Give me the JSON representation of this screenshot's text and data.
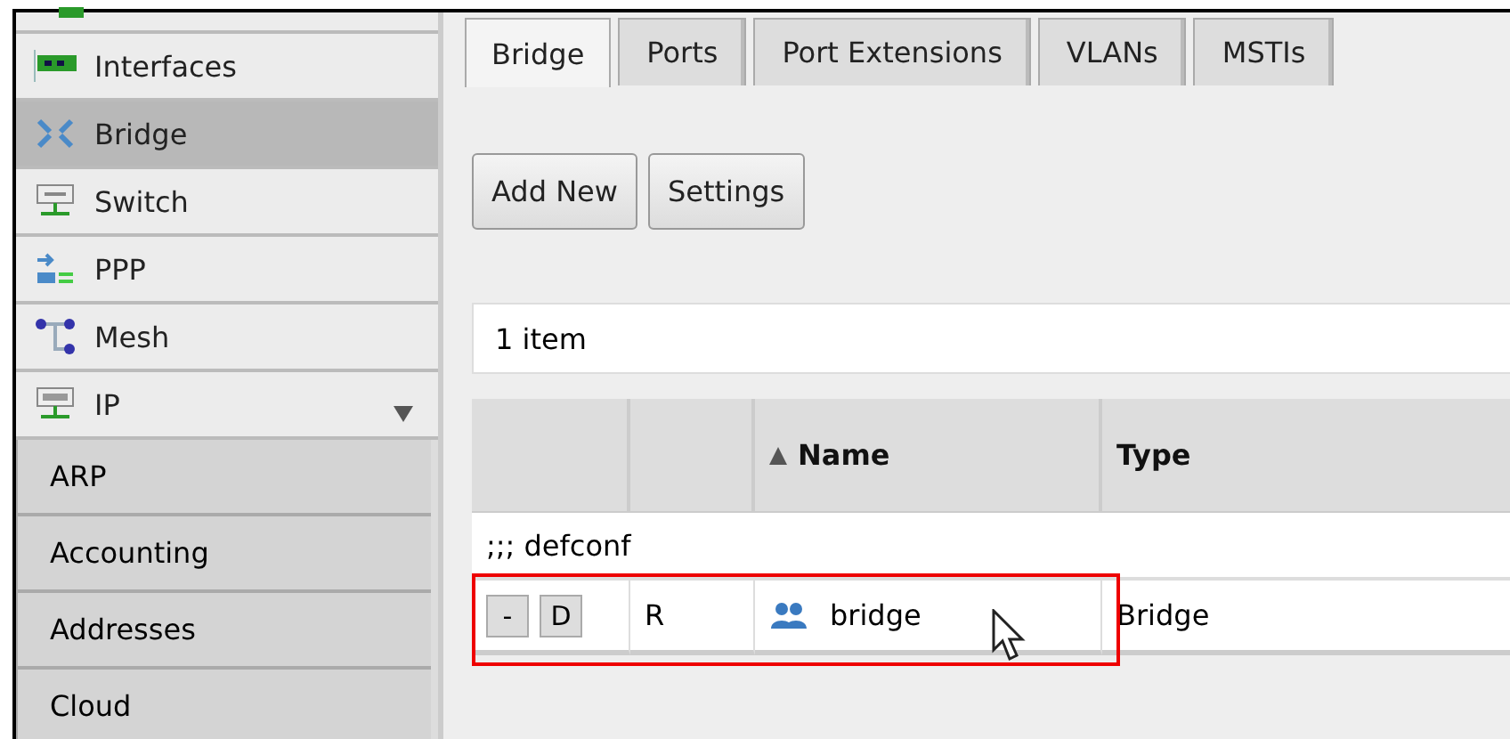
{
  "sidebar": {
    "items": [
      {
        "label": "Interfaces",
        "selected": false
      },
      {
        "label": "Bridge",
        "selected": true
      },
      {
        "label": "Switch",
        "selected": false
      },
      {
        "label": "PPP",
        "selected": false
      },
      {
        "label": "Mesh",
        "selected": false
      },
      {
        "label": "IP",
        "selected": false,
        "expanded": true,
        "children": [
          {
            "label": "ARP"
          },
          {
            "label": "Accounting"
          },
          {
            "label": "Addresses"
          },
          {
            "label": "Cloud"
          }
        ]
      }
    ]
  },
  "tabs": [
    {
      "label": "Bridge",
      "selected": true
    },
    {
      "label": "Ports",
      "selected": false
    },
    {
      "label": "Port Extensions",
      "selected": false
    },
    {
      "label": "VLANs",
      "selected": false
    },
    {
      "label": "MSTIs",
      "selected": false
    }
  ],
  "buttons": [
    "Add New",
    "Settings"
  ],
  "item_count": "1 item",
  "table": {
    "columns": [
      {
        "sorted": false
      },
      {
        "sorted": false
      },
      {
        "label": "Name",
        "sorted": true
      },
      {
        "label": "Type",
        "sorted": false
      }
    ],
    "comment": ";;; defconf",
    "rows": [
      {
        "actions": [
          "-",
          "D"
        ],
        "flags": "R",
        "name": "bridge",
        "type": "Bridge",
        "highlighted": true
      }
    ]
  }
}
